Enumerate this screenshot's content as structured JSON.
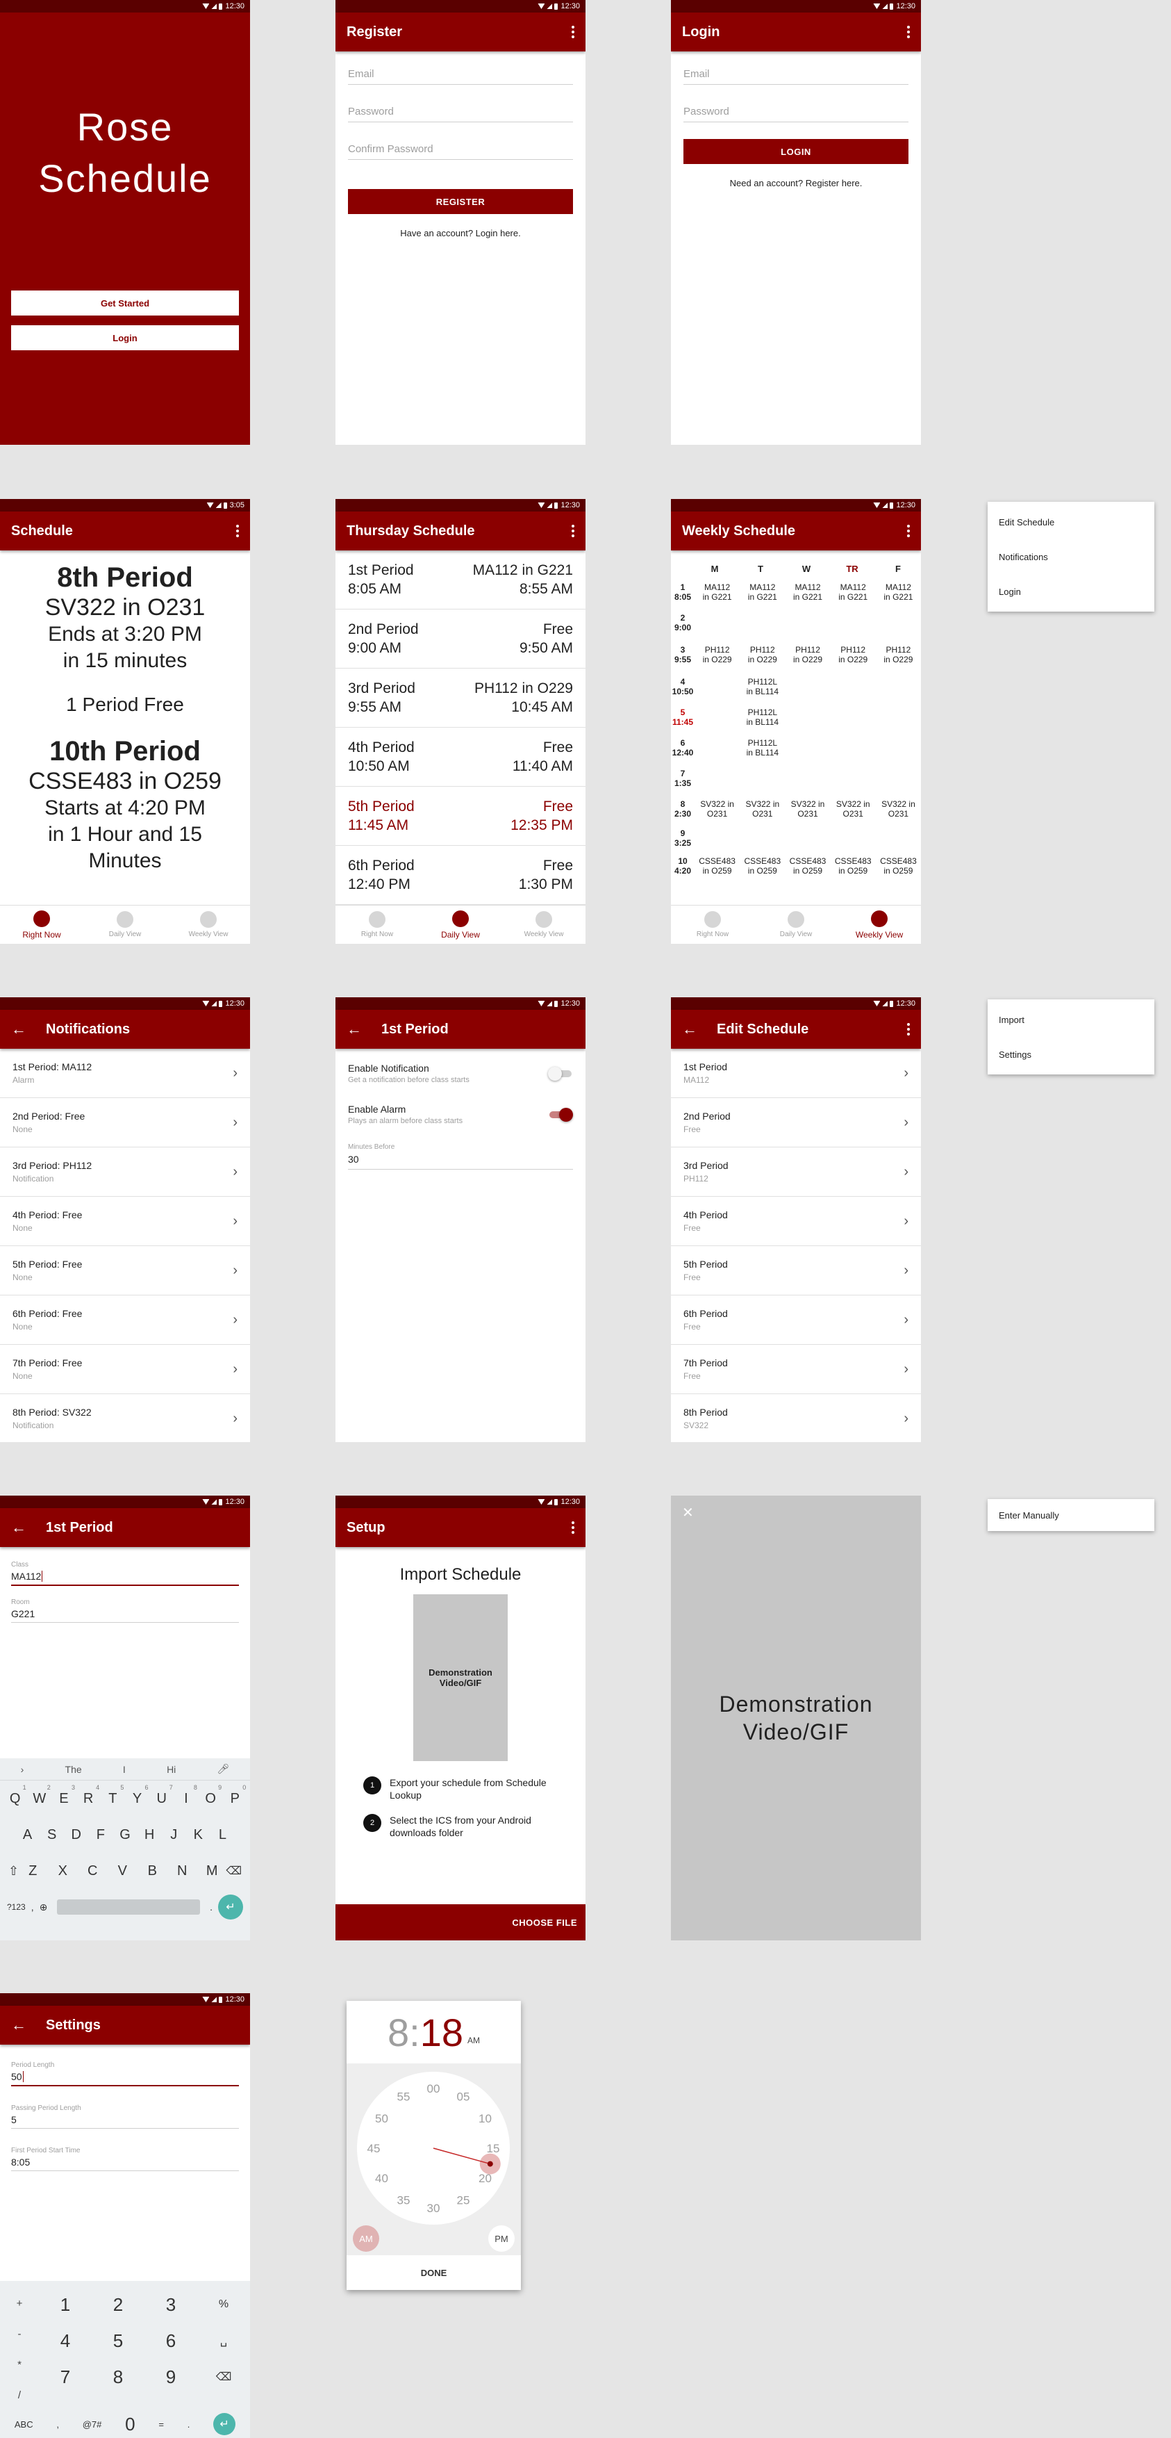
{
  "status": {
    "time": "12:30",
    "time_schedule": "3:05"
  },
  "splash": {
    "title_line1": "Rose",
    "title_line2": "Schedule",
    "get_started": "Get Started",
    "login": "Login"
  },
  "register": {
    "title": "Register",
    "email": "Email",
    "password": "Password",
    "confirm": "Confirm Password",
    "button": "REGISTER",
    "link": "Have an account? Login here."
  },
  "login": {
    "title": "Login",
    "email": "Email",
    "password": "Password",
    "button": "LOGIN",
    "link": "Need an account? Register here."
  },
  "schedule": {
    "title": "Schedule",
    "now_period": "8th Period",
    "now_class": "SV322 in O231",
    "now_ends": "Ends at 3:20 PM",
    "now_in": "in 15 minutes",
    "free": "1 Period Free",
    "next_period": "10th Period",
    "next_class": "CSSE483 in O259",
    "next_starts": "Starts at 4:20 PM",
    "next_in": "in 1 Hour and 15",
    "next_in2": "Minutes"
  },
  "nav": {
    "right_now": "Right Now",
    "daily": "Daily View",
    "weekly": "Weekly View"
  },
  "daily": {
    "title": "Thursday Schedule",
    "rows": [
      {
        "l1": "1st Period",
        "l2": "8:05 AM",
        "r1": "MA112 in G221",
        "r2": "8:55 AM"
      },
      {
        "l1": "2nd Period",
        "l2": "9:00 AM",
        "r1": "Free",
        "r2": "9:50 AM"
      },
      {
        "l1": "3rd Period",
        "l2": "9:55 AM",
        "r1": "PH112 in O229",
        "r2": "10:45 AM"
      },
      {
        "l1": "4th Period",
        "l2": "10:50 AM",
        "r1": "Free",
        "r2": "11:40 AM"
      },
      {
        "l1": "5th Period",
        "l2": "11:45 AM",
        "r1": "Free",
        "r2": "12:35 PM"
      },
      {
        "l1": "6th Period",
        "l2": "12:40 PM",
        "r1": "Free",
        "r2": "1:30 PM"
      }
    ]
  },
  "weekly": {
    "title": "Weekly Schedule",
    "days": [
      "M",
      "T",
      "W",
      "TR",
      "F"
    ],
    "rows": [
      {
        "num": "1",
        "time": "8:05",
        "cells": [
          "MA112\nin G221",
          "MA112\nin G221",
          "MA112\nin G221",
          "MA112\nin G221",
          "MA112\nin G221"
        ]
      },
      {
        "num": "2",
        "time": "9:00",
        "cells": [
          "",
          "",
          "",
          "",
          ""
        ]
      },
      {
        "num": "3",
        "time": "9:55",
        "cells": [
          "PH112\nin O229",
          "PH112\nin O229",
          "PH112\nin O229",
          "PH112\nin O229",
          "PH112\nin O229"
        ]
      },
      {
        "num": "4",
        "time": "10:50",
        "cells": [
          "",
          "PH112L\nin BL114",
          "",
          "",
          ""
        ]
      },
      {
        "num": "5",
        "time": "11:45",
        "cells": [
          "",
          "PH112L\nin BL114",
          "",
          "",
          ""
        ]
      },
      {
        "num": "6",
        "time": "12:40",
        "cells": [
          "",
          "PH112L\nin BL114",
          "",
          "",
          ""
        ]
      },
      {
        "num": "7",
        "time": "1:35",
        "cells": [
          "",
          "",
          "",
          "",
          ""
        ]
      },
      {
        "num": "8",
        "time": "2:30",
        "cells": [
          "SV322 in\nO231",
          "SV322 in\nO231",
          "SV322 in\nO231",
          "SV322 in\nO231",
          "SV322 in\nO231"
        ]
      },
      {
        "num": "9",
        "time": "3:25",
        "cells": [
          "",
          "",
          "",
          "",
          ""
        ]
      },
      {
        "num": "10",
        "time": "4:20",
        "cells": [
          "CSSE483\nin O259",
          "CSSE483\nin O259",
          "CSSE483\nin O259",
          "CSSE483\nin O259",
          "CSSE483\nin O259"
        ]
      }
    ]
  },
  "menu1": [
    "Edit Schedule",
    "Notifications",
    "Login"
  ],
  "notifications": {
    "title": "Notifications",
    "rows": [
      {
        "t1": "1st Period: MA112",
        "t2": "Alarm"
      },
      {
        "t1": "2nd Period: Free",
        "t2": "None"
      },
      {
        "t1": "3rd Period: PH112",
        "t2": "Notification"
      },
      {
        "t1": "4th Period: Free",
        "t2": "None"
      },
      {
        "t1": "5th Period: Free",
        "t2": "None"
      },
      {
        "t1": "6th Period: Free",
        "t2": "None"
      },
      {
        "t1": "7th Period: Free",
        "t2": "None"
      },
      {
        "t1": "8th Period: SV322",
        "t2": "Notification"
      }
    ]
  },
  "period_notif": {
    "title": "1st Period",
    "enable_notif": "Enable Notification",
    "enable_notif_sub": "Get a notification before class starts",
    "enable_alarm": "Enable Alarm",
    "enable_alarm_sub": "Plays an alarm before class starts",
    "minutes_label": "Minutes Before",
    "minutes_value": "30"
  },
  "edit": {
    "title": "Edit Schedule",
    "rows": [
      {
        "t1": "1st Period",
        "t2": "MA112"
      },
      {
        "t1": "2nd Period",
        "t2": "Free"
      },
      {
        "t1": "3rd Period",
        "t2": "PH112"
      },
      {
        "t1": "4th Period",
        "t2": "Free"
      },
      {
        "t1": "5th Period",
        "t2": "Free"
      },
      {
        "t1": "6th Period",
        "t2": "Free"
      },
      {
        "t1": "7th Period",
        "t2": "Free"
      },
      {
        "t1": "8th Period",
        "t2": "SV322"
      }
    ]
  },
  "menu2": [
    "Import",
    "Settings"
  ],
  "period_edit": {
    "title": "1st Period",
    "class_label": "Class",
    "class_value": "MA112",
    "room_label": "Room",
    "room_value": "G221"
  },
  "keyboard": {
    "suggestions": [
      "The",
      "I",
      "Hi"
    ],
    "row1": [
      "Q",
      "W",
      "E",
      "R",
      "T",
      "Y",
      "U",
      "I",
      "O",
      "P"
    ],
    "row1_num": [
      "1",
      "2",
      "3",
      "4",
      "5",
      "6",
      "7",
      "8",
      "9",
      "0"
    ],
    "row2": [
      "A",
      "S",
      "D",
      "F",
      "G",
      "H",
      "J",
      "K",
      "L"
    ],
    "row3": [
      "Z",
      "X",
      "C",
      "V",
      "B",
      "N",
      "M"
    ],
    "sym": "?123",
    "comma": ",",
    "period": "."
  },
  "setup": {
    "title": "Setup",
    "heading": "Import Schedule",
    "video": "Demonstration Video/GIF",
    "step1_num": "1",
    "step1": "Export your schedule from Schedule Lookup",
    "step2_num": "2",
    "step2": "Select the ICS from your Android downloads folder",
    "choose": "CHOOSE FILE"
  },
  "video_full": {
    "close": "✕",
    "label_line1": "Demonstration",
    "label_line2": "Video/GIF"
  },
  "menu3": [
    "Enter Manually"
  ],
  "settings": {
    "title": "Settings",
    "period_length_label": "Period Length",
    "period_length_value": "50",
    "passing_label": "Passing Period Length",
    "passing_value": "5",
    "start_label": "First Period Start Time",
    "start_value": "8:05"
  },
  "numpad": {
    "side": [
      "+",
      "-",
      "*",
      "/"
    ],
    "rows": [
      [
        "1",
        "2",
        "3",
        "%"
      ],
      [
        "4",
        "5",
        "6",
        "␣"
      ],
      [
        "7",
        "8",
        "9",
        "⌫"
      ]
    ],
    "bottom": [
      "ABC",
      ",",
      "@7#",
      "0",
      "=",
      "."
    ]
  },
  "clock": {
    "hour": "8",
    "colon": ":",
    "minute": "18",
    "ampm": "AM",
    "numbers": [
      "00",
      "05",
      "10",
      "15",
      "20",
      "25",
      "30",
      "35",
      "40",
      "45",
      "50",
      "55"
    ],
    "selected_minute": 18,
    "am": "AM",
    "pm": "PM",
    "done": "DONE"
  },
  "colors": {
    "primary": "#8b0000",
    "status": "#5a0000",
    "accent_teal": "#4db6ac"
  }
}
